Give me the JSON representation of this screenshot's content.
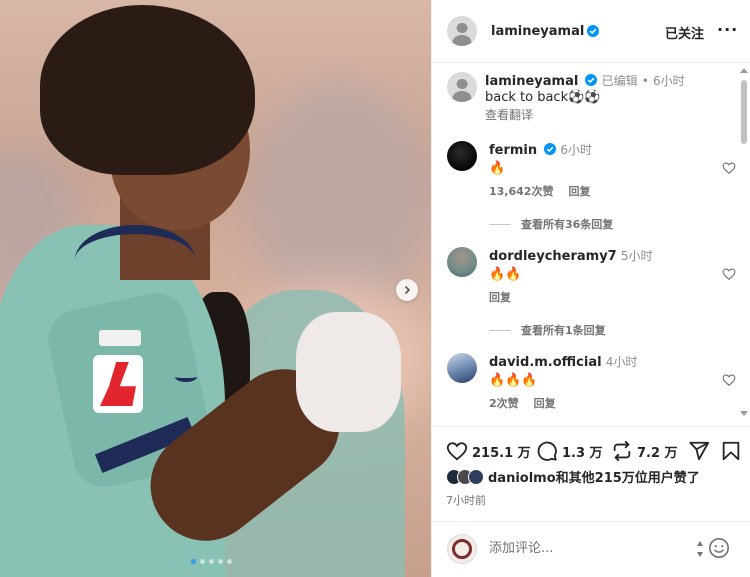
{
  "post": {
    "author": "lamineyamal",
    "follow_label": "已关注",
    "more_label": "···",
    "carousel_dots": 5,
    "carousel_active": 0
  },
  "caption": {
    "author": "lamineyamal",
    "edited": "已编辑",
    "separator": "•",
    "time": "6小时",
    "text": "back to back⚽️⚽️",
    "translate": "查看翻译"
  },
  "comments": [
    {
      "author": "fermin",
      "verified": true,
      "time": "6小时",
      "text": "🔥",
      "likes": "13,642次赞",
      "reply": "回复",
      "view_replies": "查看所有36条回复"
    },
    {
      "author": "dordleycheramy7",
      "verified": false,
      "time": "5小时",
      "text": "🔥🔥",
      "likes": "",
      "reply": "回复",
      "view_replies": "查看所有1条回复"
    },
    {
      "author": "david.m.official",
      "verified": false,
      "time": "4小时",
      "text": "🔥🔥🔥",
      "likes": "2次赞",
      "reply": "回复",
      "view_replies": ""
    }
  ],
  "actions": {
    "like_count": "215.1 万",
    "comment_count": "1.3 万",
    "repost_count": "7.2 万"
  },
  "liked_by": "daniolmo和其他215万位用户赞了",
  "posted_ago": "7小时前",
  "comment_box": {
    "placeholder": "添加评论..."
  },
  "colors": {
    "verified": "#0095f6",
    "text": "#262626",
    "muted": "#737373",
    "active_dot": "#3897f0"
  },
  "icons": [
    "next-chevron-icon",
    "heart-icon",
    "comment-icon",
    "repost-icon",
    "share-icon",
    "bookmark-icon",
    "emoji-icon",
    "verified-icon"
  ]
}
